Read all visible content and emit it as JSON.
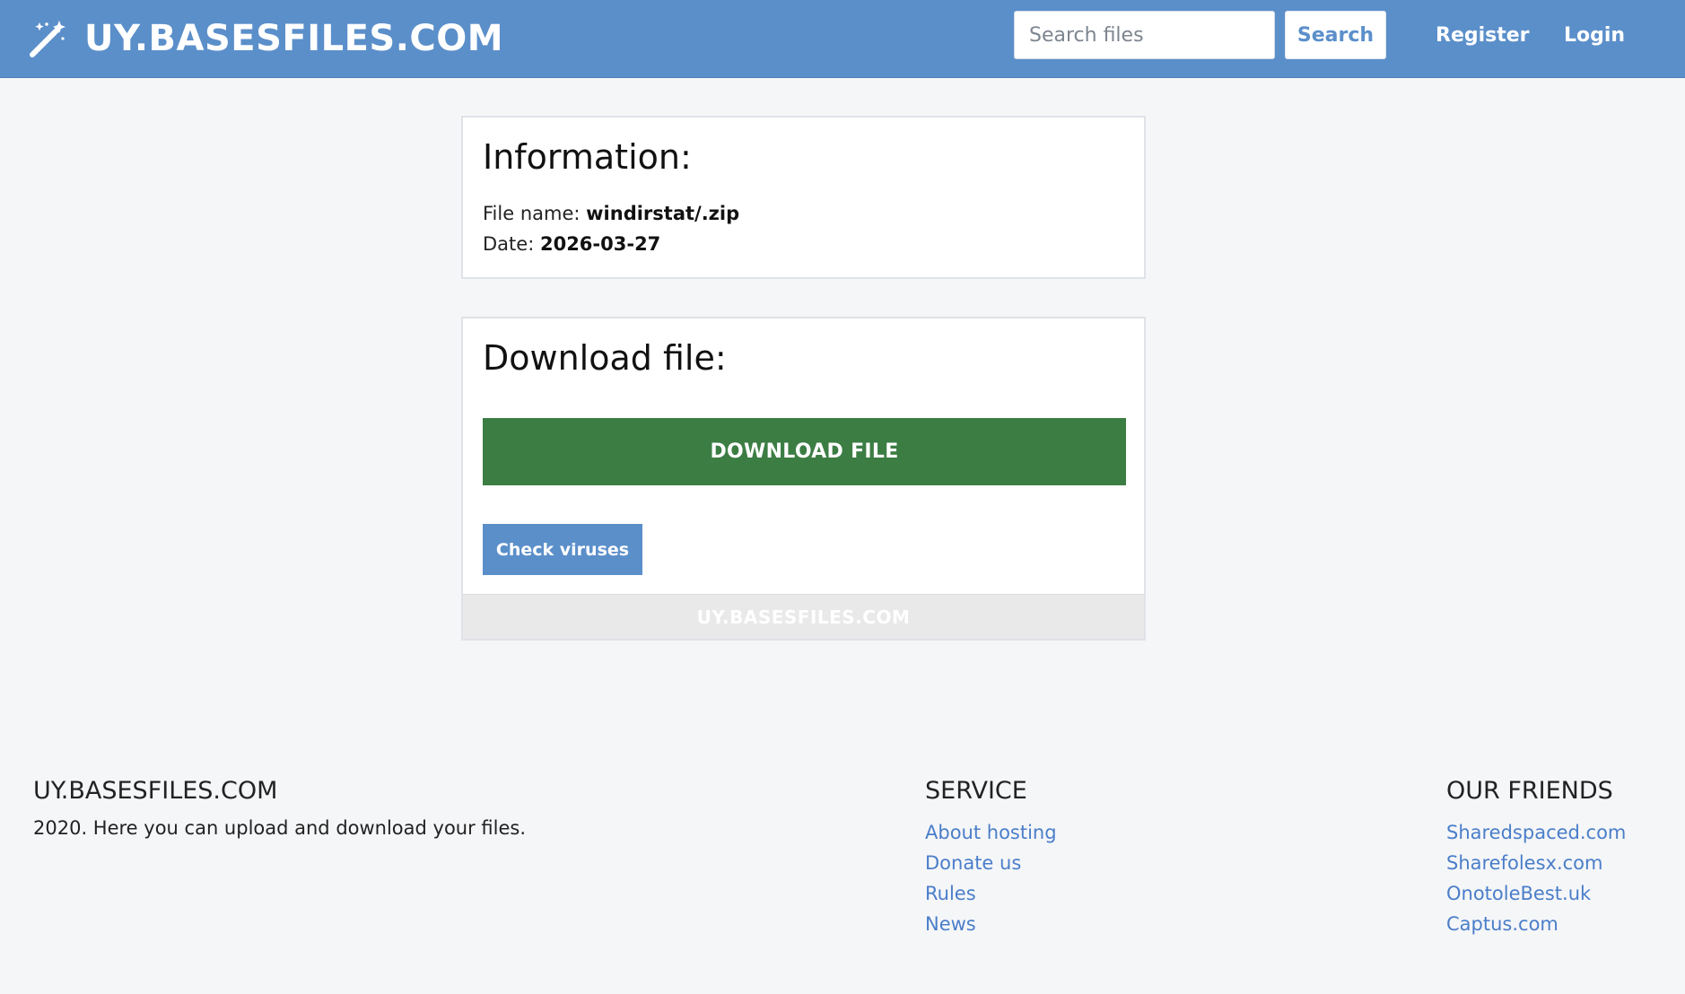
{
  "header": {
    "brand": "UY.BASESFILES.COM",
    "brand_icon": "magic-wand-icon",
    "search_placeholder": "Search files",
    "search_label": "Search",
    "register_label": "Register",
    "login_label": "Login",
    "colors": {
      "bar": "#5b8fca",
      "text": "#ffffff"
    }
  },
  "info": {
    "title": "Information:",
    "file_label": "File name:",
    "file_value": "windirstat/.zip",
    "date_label": "Date:",
    "date_value": "2026-03-27"
  },
  "download": {
    "title": "Download file:",
    "download_label": "DOWNLOAD FILE",
    "virus_label": "Check viruses",
    "watermark": "UY.BASESFILES.COM",
    "colors": {
      "download_button": "#3c7d44",
      "virus_button": "#5b8fca"
    }
  },
  "footer": {
    "brand": {
      "title": "UY.BASESFILES.COM",
      "text": "2020. Here you can upload and download your files."
    },
    "service": {
      "title": "SERVICE",
      "links": [
        "About hosting",
        "Donate us",
        "Rules",
        "News"
      ]
    },
    "friends": {
      "title": "OUR FRIENDS",
      "links": [
        "Sharedspaced.com",
        "Sharefolesx.com",
        "OnotoleBest.uk",
        "Captus.com"
      ]
    },
    "colors": {
      "link": "#4a7ec9"
    }
  }
}
